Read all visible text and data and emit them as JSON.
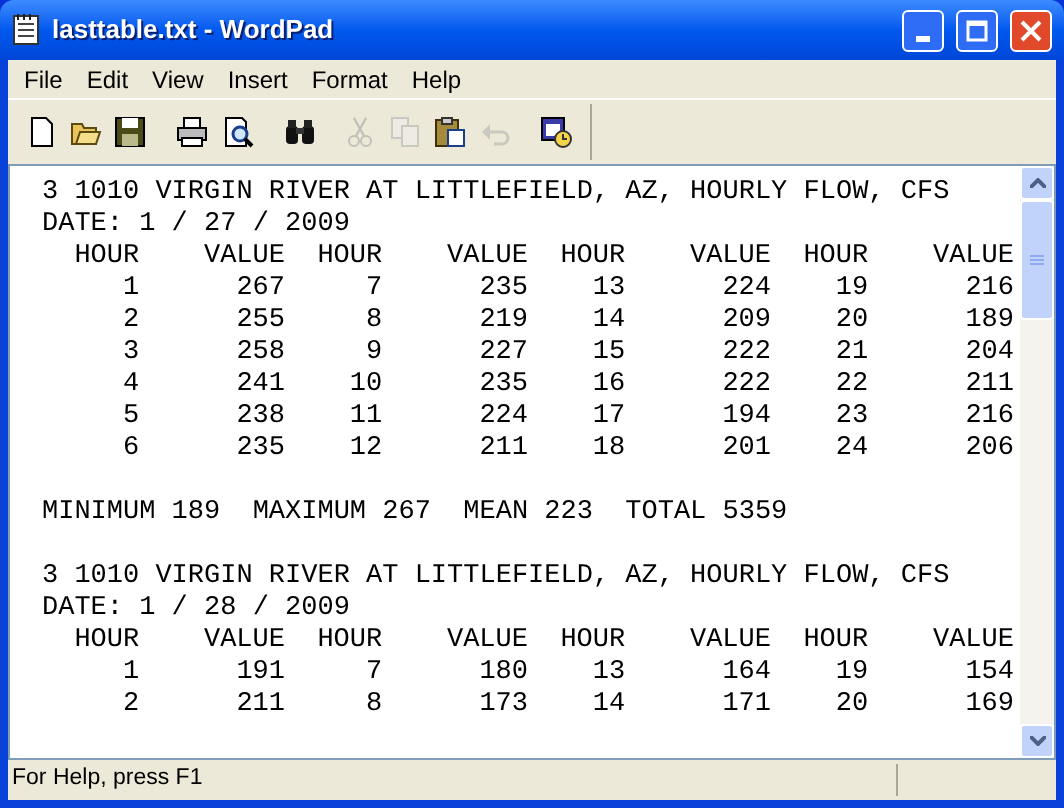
{
  "window": {
    "title": "lasttable.txt - WordPad"
  },
  "menu": [
    "File",
    "Edit",
    "View",
    "Insert",
    "Format",
    "Help"
  ],
  "toolbar": [
    {
      "kind": "new",
      "disabled": false
    },
    {
      "kind": "open",
      "disabled": false
    },
    {
      "kind": "save",
      "disabled": false
    },
    {
      "kind": "sep"
    },
    {
      "kind": "print",
      "disabled": false
    },
    {
      "kind": "preview",
      "disabled": false
    },
    {
      "kind": "sep"
    },
    {
      "kind": "find",
      "disabled": false
    },
    {
      "kind": "sep"
    },
    {
      "kind": "cut",
      "disabled": true
    },
    {
      "kind": "copy",
      "disabled": true
    },
    {
      "kind": "paste",
      "disabled": false
    },
    {
      "kind": "undo",
      "disabled": true
    },
    {
      "kind": "sep"
    },
    {
      "kind": "datetime",
      "disabled": false
    }
  ],
  "document": {
    "blocks": [
      {
        "title": "3 1010 VIRGIN RIVER AT LITTLEFIELD, AZ, HOURLY FLOW, CFS",
        "date": "DATE: 1 / 27 / 2009",
        "columns": [
          "HOUR",
          "VALUE",
          "HOUR",
          "VALUE",
          "HOUR",
          "VALUE",
          "HOUR",
          "VALUE"
        ],
        "rows": [
          [
            "1",
            "267",
            "7",
            "235",
            "13",
            "224",
            "19",
            "216"
          ],
          [
            "2",
            "255",
            "8",
            "219",
            "14",
            "209",
            "20",
            "189"
          ],
          [
            "3",
            "258",
            "9",
            "227",
            "15",
            "222",
            "21",
            "204"
          ],
          [
            "4",
            "241",
            "10",
            "235",
            "16",
            "222",
            "22",
            "211"
          ],
          [
            "5",
            "238",
            "11",
            "224",
            "17",
            "194",
            "23",
            "216"
          ],
          [
            "6",
            "235",
            "12",
            "211",
            "18",
            "201",
            "24",
            "206"
          ]
        ],
        "summary": "MINIMUM 189  MAXIMUM 267  MEAN 223  TOTAL 5359"
      },
      {
        "title": "3 1010 VIRGIN RIVER AT LITTLEFIELD, AZ, HOURLY FLOW, CFS",
        "date": "DATE: 1 / 28 / 2009",
        "columns": [
          "HOUR",
          "VALUE",
          "HOUR",
          "VALUE",
          "HOUR",
          "VALUE",
          "HOUR",
          "VALUE"
        ],
        "rows": [
          [
            "1",
            "191",
            "7",
            "180",
            "13",
            "164",
            "19",
            "154"
          ],
          [
            "2",
            "211",
            "8",
            "173",
            "14",
            "171",
            "20",
            "169"
          ]
        ]
      }
    ]
  },
  "status_bar": "For Help, press F1"
}
